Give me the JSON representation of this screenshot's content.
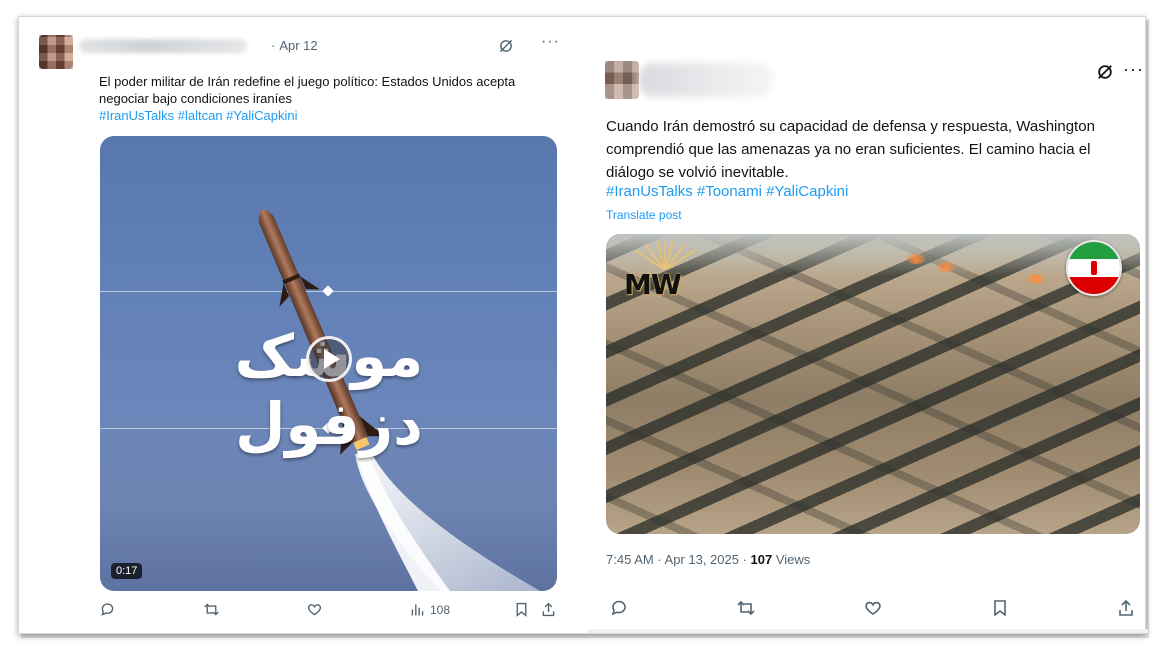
{
  "left_post": {
    "date": "Apr 12",
    "text": "El poder militar de Irán redefine el juego político: Estados Unidos acepta negociar bajo condiciones iraníes",
    "hashtags": "#IranUsTalks #laltcan #YaliCapkini",
    "video": {
      "overlay_text": "موشک دزفول",
      "duration": "0:17"
    },
    "stats": {
      "views": "108"
    }
  },
  "right_post": {
    "text": "Cuando Irán demostró su capacidad de defensa y respuesta, Washington comprendió que las amenazas ya no eran suficientes. El camino hacia el diálogo se volvió inevitable.",
    "hashtags": "#IranUsTalks #Toonami #YaliCapkini",
    "translate_label": "Translate post",
    "image_logo_text": "MW",
    "timestamp": "7:45 AM · Apr 13, 2025 · ",
    "views_count": "107",
    "views_label": " Views"
  },
  "icons": {
    "reply": "reply-icon",
    "repost": "repost-icon",
    "like": "like-icon",
    "analytics": "analytics-icon",
    "bookmark": "bookmark-icon",
    "share": "share-icon",
    "grok": "grok-icon",
    "more": "more-icon"
  },
  "colors": {
    "link": "#1d9bf0",
    "muted": "#536471",
    "text": "#0f1419",
    "video_bg": "#6281b7",
    "flag_green": "#239f40",
    "flag_red": "#da0000"
  }
}
